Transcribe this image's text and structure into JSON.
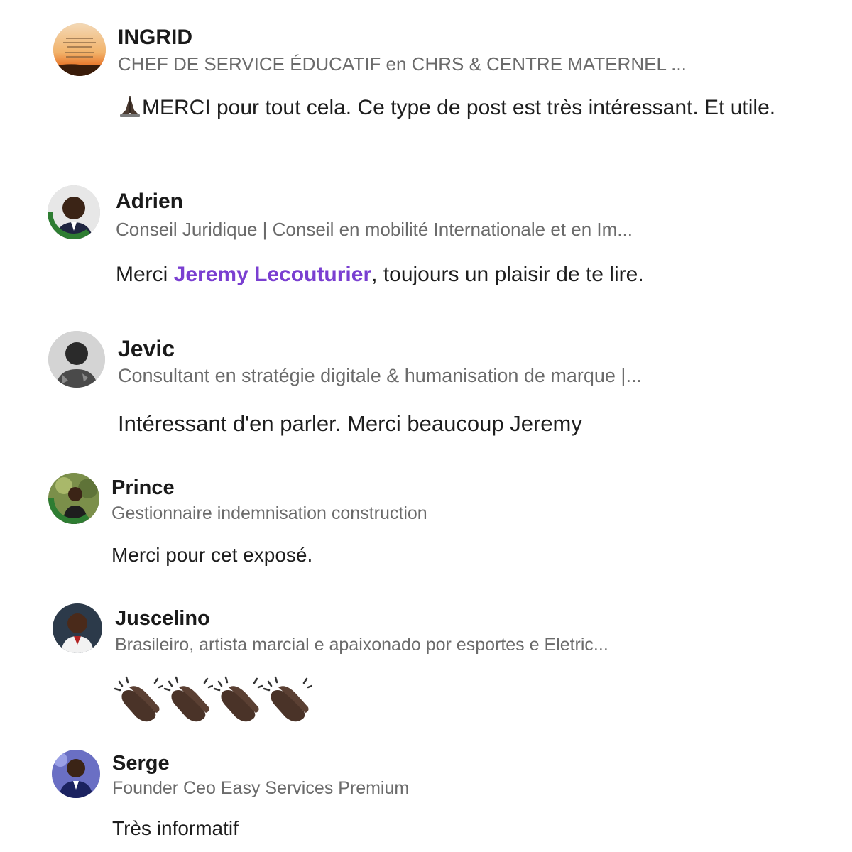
{
  "comments": [
    {
      "name": "INGRID",
      "headline": "CHEF DE SERVICE ÉDUCATIF en CHRS & CENTRE MATERNEL ...",
      "text_before": "MERCI pour tout cela. Ce type de post est très intéressant. Et utile.",
      "emoji_prefix": "pray-icon"
    },
    {
      "name": "Adrien",
      "headline": "Conseil Juridique | Conseil en mobilité Internationale et en Im...",
      "text_before": "Merci ",
      "mention": "Jeremy Lecouturier",
      "text_after": ", toujours un plaisir de te lire."
    },
    {
      "name": "Jevic",
      "headline": "Consultant en stratégie digitale & humanisation de marque |...",
      "text_before": "Intéressant d'en parler. Merci beaucoup Jeremy"
    },
    {
      "name": "Prince",
      "headline": "Gestionnaire indemnisation construction",
      "text_before": "Merci pour cet exposé."
    },
    {
      "name": "Juscelino",
      "headline": "Brasileiro, artista marcial e apaixonado por esportes e Eletric...",
      "text_before": "",
      "emoji_body": [
        "clapping-hands-icon",
        "clapping-hands-icon",
        "clapping-hands-icon",
        "clapping-hands-icon"
      ]
    },
    {
      "name": "Serge",
      "headline": "Founder Ceo Easy Services Premium",
      "text_before": "Très informatif"
    }
  ],
  "colors": {
    "mention": "#7a3fd1",
    "headline": "#6b6b6b",
    "name": "#1a1a1a",
    "open_to_work": "#2e7d32"
  }
}
